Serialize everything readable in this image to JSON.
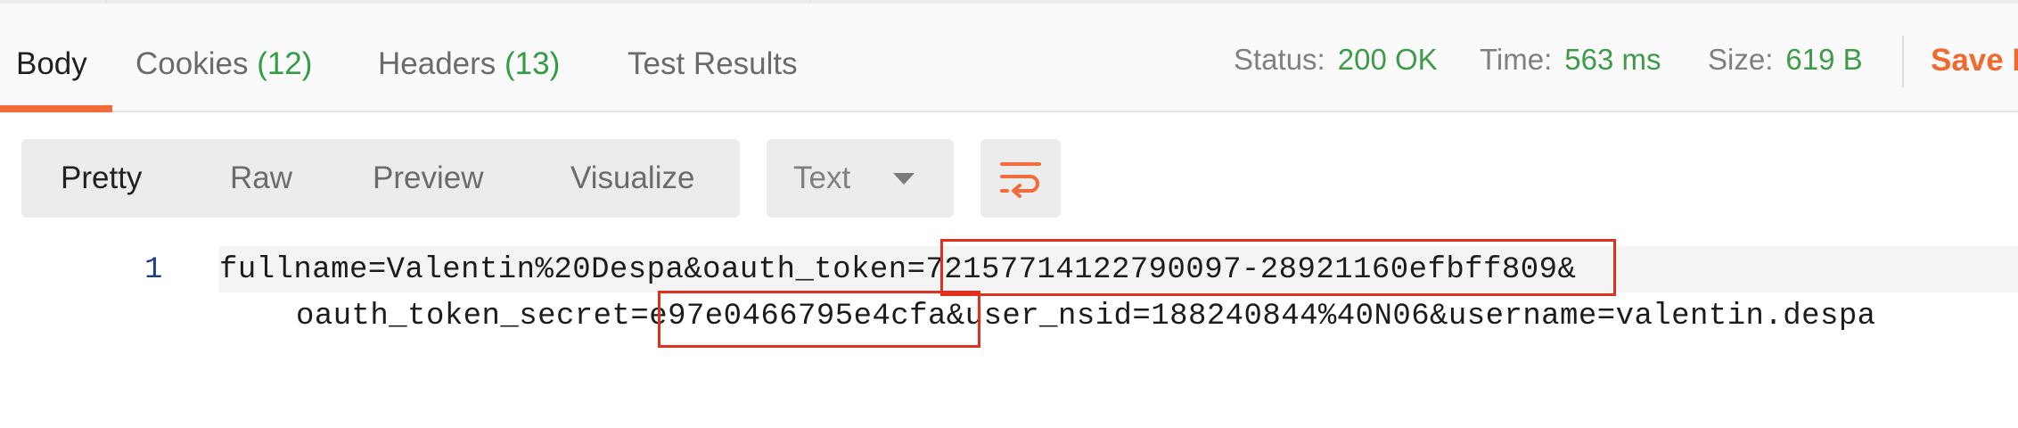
{
  "response_tabs": [
    {
      "label": "Body",
      "count": ""
    },
    {
      "label": "Cookies",
      "count": "(12)"
    },
    {
      "label": "Headers",
      "count": "(13)"
    },
    {
      "label": "Test Results",
      "count": ""
    }
  ],
  "active_tab": "Body",
  "stats": {
    "status_label": "Status:",
    "status_value": "200 OK",
    "time_label": "Time:",
    "time_value": "563 ms",
    "size_label": "Size:",
    "size_value": "619 B"
  },
  "save_label": "Save R",
  "view_options": [
    "Pretty",
    "Raw",
    "Preview",
    "Visualize"
  ],
  "active_view": "Pretty",
  "format_select": {
    "selected": "Text"
  },
  "editor": {
    "line_number": "1",
    "line1": "fullname=Valentin%20Despa&oauth_token=72157714122790097-28921160efbff809&",
    "line2": "oauth_token_secret=e97e0466795e4cfa&user_nsid=188240844%40N06&username=valentin.despa"
  },
  "colors": {
    "accent": "#f26b3a",
    "status_green": "#3d9b4a",
    "highlight_box": "#e0301e",
    "line_number": "#1d3c87"
  },
  "icons": {
    "wrap": "text-wrap-icon",
    "dropdown": "chevron-down-icon"
  }
}
